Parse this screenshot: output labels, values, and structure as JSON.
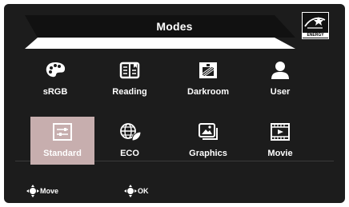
{
  "window": {
    "title": "Modes"
  },
  "energy_badge": {
    "text": "ENERGY STAR"
  },
  "modes": [
    {
      "label": "sRGB",
      "icon": "palette-icon",
      "selected": false
    },
    {
      "label": "Reading",
      "icon": "open-book-icon",
      "selected": false
    },
    {
      "label": "Darkroom",
      "icon": "darkroom-icon",
      "selected": false
    },
    {
      "label": "User",
      "icon": "user-icon",
      "selected": false
    },
    {
      "label": "Standard",
      "icon": "sliders-icon",
      "selected": true
    },
    {
      "label": "ECO",
      "icon": "eco-globe-icon",
      "selected": false
    },
    {
      "label": "Graphics",
      "icon": "images-icon",
      "selected": false
    },
    {
      "label": "Movie",
      "icon": "film-icon",
      "selected": false
    }
  ],
  "footer": {
    "move_label": "Move",
    "ok_label": "OK"
  },
  "colors": {
    "background": "#1c1c1c",
    "selected_tile": "#c7aeae",
    "text": "#ffffff"
  }
}
